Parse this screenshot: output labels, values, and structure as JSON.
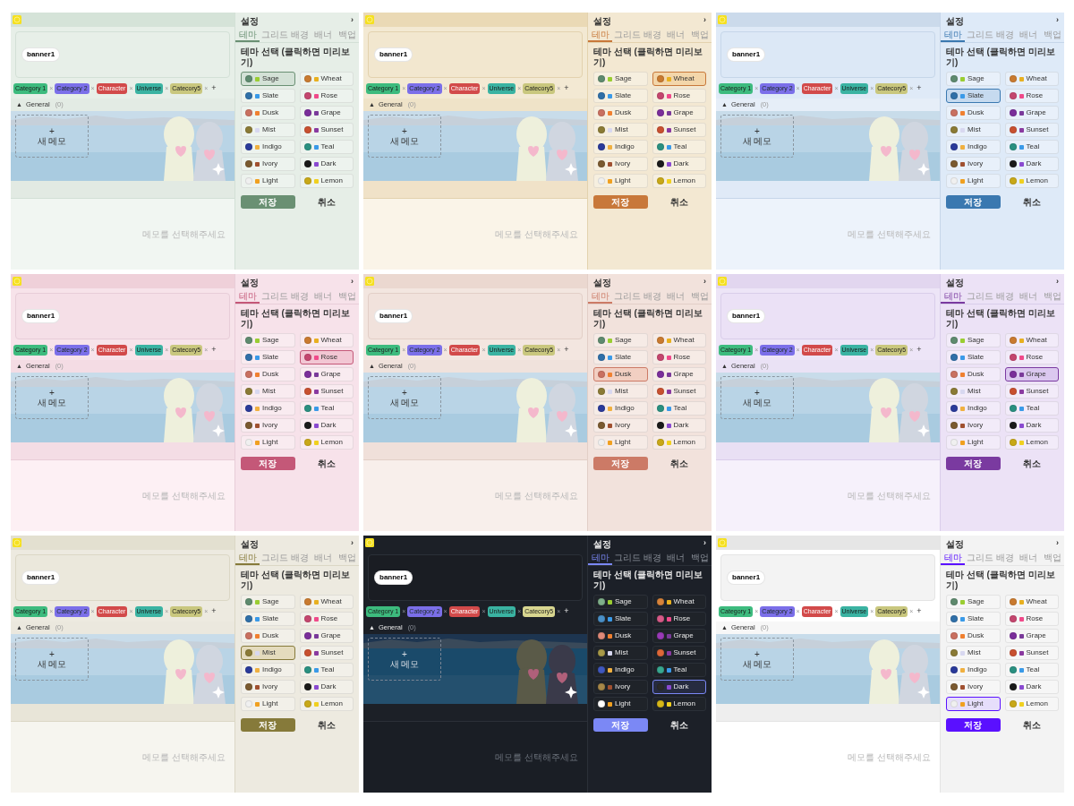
{
  "panels": [
    {
      "banner": {
        "label": "banner1"
      },
      "categories": [
        {
          "label": "Category 1",
          "color": "#3dbb7e",
          "remove": "×"
        },
        {
          "label": "Category 2",
          "color": "#7b6fe9",
          "remove": "×"
        },
        {
          "label": "Character",
          "color": "#d24a4a",
          "remove": "×"
        },
        {
          "label": "Universe",
          "color": "#3ab3a2",
          "remove": "×"
        },
        {
          "label": "Catecory5",
          "color": "#c9c77e",
          "remove": "×"
        }
      ],
      "add_category": "+",
      "group": {
        "toggle": "▲",
        "label": "General",
        "count": "(0)"
      },
      "new_memo": {
        "plus": "+",
        "label": "새 메모"
      },
      "empty_hint": "메모를 선택해주세요",
      "settings": {
        "title": "설정",
        "collapse": "›",
        "tabs": [
          {
            "label": "테마",
            "selected": true
          },
          {
            "label": "그리드 배경",
            "selected": false
          },
          {
            "label": "배너",
            "selected": false
          },
          {
            "label": "백업",
            "selected": false
          }
        ],
        "section_title": "테마 선택 (클릭하면 미리보기)",
        "themes": [
          {
            "label": "Sage",
            "color": "#5e8a6e",
            "selected": true
          },
          {
            "label": "Wheat",
            "color": "#c97a30",
            "selected": false
          },
          {
            "label": "Slate",
            "color": "#2f6fa8",
            "selected": false
          },
          {
            "label": "Rose",
            "color": "#c4466e",
            "selected": false
          },
          {
            "label": "Dusk",
            "color": "#c97060",
            "selected": false
          },
          {
            "label": "Grape",
            "color": "#7a2e9a",
            "selected": false
          },
          {
            "label": "Mist",
            "color": "#8a7a35",
            "selected": false
          },
          {
            "label": "Sunset",
            "color": "#c85030",
            "selected": false
          },
          {
            "label": "Indigo",
            "color": "#2a3a9a",
            "selected": false
          },
          {
            "label": "Teal",
            "color": "#2a9080",
            "selected": false
          },
          {
            "label": "Ivory",
            "color": "#7a5a30",
            "selected": false
          },
          {
            "label": "Dark",
            "color": "#1a1a1a",
            "selected": false
          },
          {
            "label": "Light",
            "color": "#f0f0f0",
            "selected": false
          },
          {
            "label": "Lemon",
            "color": "#c8a818",
            "selected": false
          }
        ],
        "buttons": [
          "저장",
          "취소"
        ]
      }
    },
    {
      "banner": {
        "label": "banner1"
      },
      "categories": [
        {
          "label": "Category 1",
          "color": "#3dbb7e",
          "remove": "×"
        },
        {
          "label": "Category 2",
          "color": "#7b6fe9",
          "remove": "×"
        },
        {
          "label": "Character",
          "color": "#d24a4a",
          "remove": "×"
        },
        {
          "label": "Universe",
          "color": "#3ab3a2",
          "remove": "×"
        },
        {
          "label": "Catecory5",
          "color": "#c9c77e",
          "remove": "×"
        }
      ],
      "add_category": "+",
      "group": {
        "toggle": "▲",
        "label": "General",
        "count": "(0)"
      },
      "new_memo": {
        "plus": "+",
        "label": "새 메모"
      },
      "empty_hint": "메모를 선택해주세요",
      "settings": {
        "title": "설정",
        "collapse": "›",
        "tabs": [
          {
            "label": "테마",
            "selected": true
          },
          {
            "label": "그리드 배경",
            "selected": false
          },
          {
            "label": "배너",
            "selected": false
          },
          {
            "label": "백업",
            "selected": false
          }
        ],
        "section_title": "테마 선택 (클릭하면 미리보기)",
        "themes": [
          {
            "label": "Sage",
            "color": "#5e8a6e",
            "selected": false
          },
          {
            "label": "Wheat",
            "color": "#c97a30",
            "selected": true
          },
          {
            "label": "Slate",
            "color": "#2f6fa8",
            "selected": false
          },
          {
            "label": "Rose",
            "color": "#c4466e",
            "selected": false
          },
          {
            "label": "Dusk",
            "color": "#c97060",
            "selected": false
          },
          {
            "label": "Grape",
            "color": "#7a2e9a",
            "selected": false
          },
          {
            "label": "Mist",
            "color": "#8a7a35",
            "selected": false
          },
          {
            "label": "Sunset",
            "color": "#c85030",
            "selected": false
          },
          {
            "label": "Indigo",
            "color": "#2a3a9a",
            "selected": false
          },
          {
            "label": "Teal",
            "color": "#2a9080",
            "selected": false
          },
          {
            "label": "Ivory",
            "color": "#7a5a30",
            "selected": false
          },
          {
            "label": "Dark",
            "color": "#1a1a1a",
            "selected": false
          },
          {
            "label": "Light",
            "color": "#f0f0f0",
            "selected": false
          },
          {
            "label": "Lemon",
            "color": "#c8a818",
            "selected": false
          }
        ],
        "buttons": [
          "저장",
          "취소"
        ]
      }
    },
    {
      "banner": {
        "label": "banner1"
      },
      "categories": [
        {
          "label": "Category 1",
          "color": "#3dbb7e",
          "remove": "×"
        },
        {
          "label": "Category 2",
          "color": "#7b6fe9",
          "remove": "×"
        },
        {
          "label": "Character",
          "color": "#d24a4a",
          "remove": "×"
        },
        {
          "label": "Universe",
          "color": "#3ab3a2",
          "remove": "×"
        },
        {
          "label": "Catecory5",
          "color": "#c9c77e",
          "remove": "×"
        }
      ],
      "add_category": "+",
      "group": {
        "toggle": "▲",
        "label": "General",
        "count": "(0)"
      },
      "new_memo": {
        "plus": "+",
        "label": "새 메모"
      },
      "empty_hint": "메모를 선택해주세요",
      "settings": {
        "title": "설정",
        "collapse": "›",
        "tabs": [
          {
            "label": "테마",
            "selected": true
          },
          {
            "label": "그리드 배경",
            "selected": false
          },
          {
            "label": "배너",
            "selected": false
          },
          {
            "label": "백업",
            "selected": false
          }
        ],
        "section_title": "테마 선택 (클릭하면 미리보기)",
        "themes": [
          {
            "label": "Sage",
            "color": "#5e8a6e",
            "selected": false
          },
          {
            "label": "Wheat",
            "color": "#c97a30",
            "selected": false
          },
          {
            "label": "Slate",
            "color": "#2f6fa8",
            "selected": true
          },
          {
            "label": "Rose",
            "color": "#c4466e",
            "selected": false
          },
          {
            "label": "Dusk",
            "color": "#c97060",
            "selected": false
          },
          {
            "label": "Grape",
            "color": "#7a2e9a",
            "selected": false
          },
          {
            "label": "Mist",
            "color": "#8a7a35",
            "selected": false
          },
          {
            "label": "Sunset",
            "color": "#c85030",
            "selected": false
          },
          {
            "label": "Indigo",
            "color": "#2a3a9a",
            "selected": false
          },
          {
            "label": "Teal",
            "color": "#2a9080",
            "selected": false
          },
          {
            "label": "Ivory",
            "color": "#7a5a30",
            "selected": false
          },
          {
            "label": "Dark",
            "color": "#1a1a1a",
            "selected": false
          },
          {
            "label": "Light",
            "color": "#f0f0f0",
            "selected": false
          },
          {
            "label": "Lemon",
            "color": "#c8a818",
            "selected": false
          }
        ],
        "buttons": [
          "저장",
          "취소"
        ]
      }
    },
    {
      "banner": {
        "label": "banner1"
      },
      "categories": [
        {
          "label": "Category 1",
          "color": "#3dbb7e",
          "remove": "×"
        },
        {
          "label": "Category 2",
          "color": "#7b6fe9",
          "remove": "×"
        },
        {
          "label": "Character",
          "color": "#d24a4a",
          "remove": "×"
        },
        {
          "label": "Universe",
          "color": "#3ab3a2",
          "remove": "×"
        },
        {
          "label": "Catecory5",
          "color": "#c9c77e",
          "remove": "×"
        }
      ],
      "add_category": "+",
      "group": {
        "toggle": "▲",
        "label": "General",
        "count": "(0)"
      },
      "new_memo": {
        "plus": "+",
        "label": "새 메모"
      },
      "empty_hint": "메모를 선택해주세요",
      "settings": {
        "title": "설정",
        "collapse": "›",
        "tabs": [
          {
            "label": "테마",
            "selected": true
          },
          {
            "label": "그리드 배경",
            "selected": false
          },
          {
            "label": "배너",
            "selected": false
          },
          {
            "label": "백업",
            "selected": false
          }
        ],
        "section_title": "테마 선택 (클릭하면 미리보기)",
        "themes": [
          {
            "label": "Sage",
            "color": "#5e8a6e",
            "selected": false
          },
          {
            "label": "Wheat",
            "color": "#c97a30",
            "selected": false
          },
          {
            "label": "Slate",
            "color": "#2f6fa8",
            "selected": false
          },
          {
            "label": "Rose",
            "color": "#c4466e",
            "selected": true
          },
          {
            "label": "Dusk",
            "color": "#c97060",
            "selected": false
          },
          {
            "label": "Grape",
            "color": "#7a2e9a",
            "selected": false
          },
          {
            "label": "Mist",
            "color": "#8a7a35",
            "selected": false
          },
          {
            "label": "Sunset",
            "color": "#c85030",
            "selected": false
          },
          {
            "label": "Indigo",
            "color": "#2a3a9a",
            "selected": false
          },
          {
            "label": "Teal",
            "color": "#2a9080",
            "selected": false
          },
          {
            "label": "Ivory",
            "color": "#7a5a30",
            "selected": false
          },
          {
            "label": "Dark",
            "color": "#1a1a1a",
            "selected": false
          },
          {
            "label": "Light",
            "color": "#f0f0f0",
            "selected": false
          },
          {
            "label": "Lemon",
            "color": "#c8a818",
            "selected": false
          }
        ],
        "buttons": [
          "저장",
          "취소"
        ]
      }
    },
    {
      "banner": {
        "label": "banner1"
      },
      "categories": [
        {
          "label": "Category 1",
          "color": "#3dbb7e",
          "remove": "×"
        },
        {
          "label": "Category 2",
          "color": "#7b6fe9",
          "remove": "×"
        },
        {
          "label": "Character",
          "color": "#d24a4a",
          "remove": "×"
        },
        {
          "label": "Universe",
          "color": "#3ab3a2",
          "remove": "×"
        },
        {
          "label": "Catecory5",
          "color": "#c9c77e",
          "remove": "×"
        }
      ],
      "add_category": "+",
      "group": {
        "toggle": "▲",
        "label": "General",
        "count": "(0)"
      },
      "new_memo": {
        "plus": "+",
        "label": "새 메모"
      },
      "empty_hint": "메모를 선택해주세요",
      "settings": {
        "title": "설정",
        "collapse": "›",
        "tabs": [
          {
            "label": "테마",
            "selected": true
          },
          {
            "label": "그리드 배경",
            "selected": false
          },
          {
            "label": "배너",
            "selected": false
          },
          {
            "label": "백업",
            "selected": false
          }
        ],
        "section_title": "테마 선택 (클릭하면 미리보기)",
        "themes": [
          {
            "label": "Sage",
            "color": "#5e8a6e",
            "selected": false
          },
          {
            "label": "Wheat",
            "color": "#c97a30",
            "selected": false
          },
          {
            "label": "Slate",
            "color": "#2f6fa8",
            "selected": false
          },
          {
            "label": "Rose",
            "color": "#c4466e",
            "selected": false
          },
          {
            "label": "Dusk",
            "color": "#c97060",
            "selected": true
          },
          {
            "label": "Grape",
            "color": "#7a2e9a",
            "selected": false
          },
          {
            "label": "Mist",
            "color": "#8a7a35",
            "selected": false
          },
          {
            "label": "Sunset",
            "color": "#c85030",
            "selected": false
          },
          {
            "label": "Indigo",
            "color": "#2a3a9a",
            "selected": false
          },
          {
            "label": "Teal",
            "color": "#2a9080",
            "selected": false
          },
          {
            "label": "Ivory",
            "color": "#7a5a30",
            "selected": false
          },
          {
            "label": "Dark",
            "color": "#1a1a1a",
            "selected": false
          },
          {
            "label": "Light",
            "color": "#f0f0f0",
            "selected": false
          },
          {
            "label": "Lemon",
            "color": "#c8a818",
            "selected": false
          }
        ],
        "buttons": [
          "저장",
          "취소"
        ]
      }
    },
    {
      "banner": {
        "label": "banner1"
      },
      "categories": [
        {
          "label": "Category 1",
          "color": "#3dbb7e",
          "remove": "×"
        },
        {
          "label": "Category 2",
          "color": "#7b6fe9",
          "remove": "×"
        },
        {
          "label": "Character",
          "color": "#d24a4a",
          "remove": "×"
        },
        {
          "label": "Universe",
          "color": "#3ab3a2",
          "remove": "×"
        },
        {
          "label": "Catecory5",
          "color": "#c9c77e",
          "remove": "×"
        }
      ],
      "add_category": "+",
      "group": {
        "toggle": "▲",
        "label": "General",
        "count": "(0)"
      },
      "new_memo": {
        "plus": "+",
        "label": "새 메모"
      },
      "empty_hint": "메모를 선택해주세요",
      "settings": {
        "title": "설정",
        "collapse": "›",
        "tabs": [
          {
            "label": "테마",
            "selected": true
          },
          {
            "label": "그리드 배경",
            "selected": false
          },
          {
            "label": "배너",
            "selected": false
          },
          {
            "label": "백업",
            "selected": false
          }
        ],
        "section_title": "테마 선택 (클릭하면 미리보기)",
        "themes": [
          {
            "label": "Sage",
            "color": "#5e8a6e",
            "selected": false
          },
          {
            "label": "Wheat",
            "color": "#c97a30",
            "selected": false
          },
          {
            "label": "Slate",
            "color": "#2f6fa8",
            "selected": false
          },
          {
            "label": "Rose",
            "color": "#c4466e",
            "selected": false
          },
          {
            "label": "Dusk",
            "color": "#c97060",
            "selected": false
          },
          {
            "label": "Grape",
            "color": "#7a2e9a",
            "selected": true
          },
          {
            "label": "Mist",
            "color": "#8a7a35",
            "selected": false
          },
          {
            "label": "Sunset",
            "color": "#c85030",
            "selected": false
          },
          {
            "label": "Indigo",
            "color": "#2a3a9a",
            "selected": false
          },
          {
            "label": "Teal",
            "color": "#2a9080",
            "selected": false
          },
          {
            "label": "Ivory",
            "color": "#7a5a30",
            "selected": false
          },
          {
            "label": "Dark",
            "color": "#1a1a1a",
            "selected": false
          },
          {
            "label": "Light",
            "color": "#f0f0f0",
            "selected": false
          },
          {
            "label": "Lemon",
            "color": "#c8a818",
            "selected": false
          }
        ],
        "buttons": [
          "저장",
          "취소"
        ]
      }
    },
    {
      "banner": {
        "label": "banner1"
      },
      "categories": [
        {
          "label": "Category 1",
          "color": "#3dbb7e",
          "remove": "×"
        },
        {
          "label": "Category 2",
          "color": "#7b6fe9",
          "remove": "×"
        },
        {
          "label": "Character",
          "color": "#d24a4a",
          "remove": "×"
        },
        {
          "label": "Universe",
          "color": "#3ab3a2",
          "remove": "×"
        },
        {
          "label": "Catecory5",
          "color": "#c9c77e",
          "remove": "×"
        }
      ],
      "add_category": "+",
      "group": {
        "toggle": "▲",
        "label": "General",
        "count": "(0)"
      },
      "new_memo": {
        "plus": "+",
        "label": "새 메모"
      },
      "empty_hint": "메모를 선택해주세요",
      "settings": {
        "title": "설정",
        "collapse": "›",
        "tabs": [
          {
            "label": "테마",
            "selected": true
          },
          {
            "label": "그리드 배경",
            "selected": false
          },
          {
            "label": "배너",
            "selected": false
          },
          {
            "label": "백업",
            "selected": false
          }
        ],
        "section_title": "테마 선택 (클릭하면 미리보기)",
        "themes": [
          {
            "label": "Sage",
            "color": "#5e8a6e",
            "selected": false
          },
          {
            "label": "Wheat",
            "color": "#c97a30",
            "selected": false
          },
          {
            "label": "Slate",
            "color": "#2f6fa8",
            "selected": false
          },
          {
            "label": "Rose",
            "color": "#c4466e",
            "selected": false
          },
          {
            "label": "Dusk",
            "color": "#c97060",
            "selected": false
          },
          {
            "label": "Grape",
            "color": "#7a2e9a",
            "selected": false
          },
          {
            "label": "Mist",
            "color": "#8a7a35",
            "selected": true
          },
          {
            "label": "Sunset",
            "color": "#c85030",
            "selected": false
          },
          {
            "label": "Indigo",
            "color": "#2a3a9a",
            "selected": false
          },
          {
            "label": "Teal",
            "color": "#2a9080",
            "selected": false
          },
          {
            "label": "Ivory",
            "color": "#7a5a30",
            "selected": false
          },
          {
            "label": "Dark",
            "color": "#1a1a1a",
            "selected": false
          },
          {
            "label": "Light",
            "color": "#f0f0f0",
            "selected": false
          },
          {
            "label": "Lemon",
            "color": "#c8a818",
            "selected": false
          }
        ],
        "buttons": [
          "저장",
          "취소"
        ]
      }
    },
    {
      "banner": {
        "label": "banner1"
      },
      "categories": [
        {
          "label": "Category 1",
          "color": "#3dbb7e",
          "remove": "×"
        },
        {
          "label": "Category 2",
          "color": "#7b6fe9",
          "remove": "×"
        },
        {
          "label": "Character",
          "color": "#d24a4a",
          "remove": "×"
        },
        {
          "label": "Universe",
          "color": "#3ab3a2",
          "remove": "×"
        },
        {
          "label": "Catecory5",
          "color": "#d8d690",
          "remove": "×"
        }
      ],
      "add_category": "+",
      "group": {
        "toggle": "▲",
        "label": "General",
        "count": "(0)"
      },
      "new_memo": {
        "plus": "+",
        "label": "새 메모"
      },
      "empty_hint": "메모를 선택해주세요",
      "settings": {
        "title": "설정",
        "collapse": "›",
        "tabs": [
          {
            "label": "테마",
            "selected": true
          },
          {
            "label": "그리드 배경",
            "selected": false
          },
          {
            "label": "배너",
            "selected": false
          },
          {
            "label": "백업",
            "selected": false
          }
        ],
        "section_title": "테마 선택 (클릭하면 미리보기)",
        "themes": [
          {
            "label": "Sage",
            "color": "#7fb08a",
            "selected": false
          },
          {
            "label": "Wheat",
            "color": "#d8843a",
            "selected": false
          },
          {
            "label": "Slate",
            "color": "#4a90c8",
            "selected": false
          },
          {
            "label": "Rose",
            "color": "#d85a88",
            "selected": false
          },
          {
            "label": "Dusk",
            "color": "#e08a78",
            "selected": false
          },
          {
            "label": "Grape",
            "color": "#9a3ab8",
            "selected": false
          },
          {
            "label": "Mist",
            "color": "#a89a48",
            "selected": false
          },
          {
            "label": "Sunset",
            "color": "#e06838",
            "selected": false
          },
          {
            "label": "Indigo",
            "color": "#4058c0",
            "selected": false
          },
          {
            "label": "Teal",
            "color": "#38a890",
            "selected": false
          },
          {
            "label": "Ivory",
            "color": "#a88848",
            "selected": false
          },
          {
            "label": "Dark",
            "color": "#2a2a2a",
            "selected": true
          },
          {
            "label": "Light",
            "color": "#ffffff",
            "selected": false
          },
          {
            "label": "Lemon",
            "color": "#d8b818",
            "selected": false
          }
        ],
        "buttons": [
          "저장",
          "취소"
        ]
      }
    },
    {
      "banner": {
        "label": "banner1"
      },
      "categories": [
        {
          "label": "Category 1",
          "color": "#3dbb7e",
          "remove": "×"
        },
        {
          "label": "Category 2",
          "color": "#7b6fe9",
          "remove": "×"
        },
        {
          "label": "Character",
          "color": "#d24a4a",
          "remove": "×"
        },
        {
          "label": "Universe",
          "color": "#3ab3a2",
          "remove": "×"
        },
        {
          "label": "Catecory5",
          "color": "#c9c77e",
          "remove": "×"
        }
      ],
      "add_category": "+",
      "group": {
        "toggle": "▲",
        "label": "General",
        "count": "(0)"
      },
      "new_memo": {
        "plus": "+",
        "label": "새 메모"
      },
      "empty_hint": "메모를 선택해주세요",
      "settings": {
        "title": "설정",
        "collapse": "›",
        "tabs": [
          {
            "label": "테마",
            "selected": true
          },
          {
            "label": "그리드 배경",
            "selected": false
          },
          {
            "label": "배너",
            "selected": false
          },
          {
            "label": "백업",
            "selected": false
          }
        ],
        "section_title": "테마 선택 (클릭하면 미리보기)",
        "themes": [
          {
            "label": "Sage",
            "color": "#5e8a6e",
            "selected": false
          },
          {
            "label": "Wheat",
            "color": "#c97a30",
            "selected": false
          },
          {
            "label": "Slate",
            "color": "#2f6fa8",
            "selected": false
          },
          {
            "label": "Rose",
            "color": "#c4466e",
            "selected": false
          },
          {
            "label": "Dusk",
            "color": "#c97060",
            "selected": false
          },
          {
            "label": "Grape",
            "color": "#7a2e9a",
            "selected": false
          },
          {
            "label": "Mist",
            "color": "#8a7a35",
            "selected": false
          },
          {
            "label": "Sunset",
            "color": "#c85030",
            "selected": false
          },
          {
            "label": "Indigo",
            "color": "#2a3a9a",
            "selected": false
          },
          {
            "label": "Teal",
            "color": "#2a9080",
            "selected": false
          },
          {
            "label": "Ivory",
            "color": "#7a5a30",
            "selected": false
          },
          {
            "label": "Dark",
            "color": "#1a1a1a",
            "selected": false
          },
          {
            "label": "Light",
            "color": "#f0f0f0",
            "selected": true
          },
          {
            "label": "Lemon",
            "color": "#c8a818",
            "selected": false
          }
        ],
        "buttons": [
          "저장",
          "취소"
        ]
      }
    }
  ]
}
